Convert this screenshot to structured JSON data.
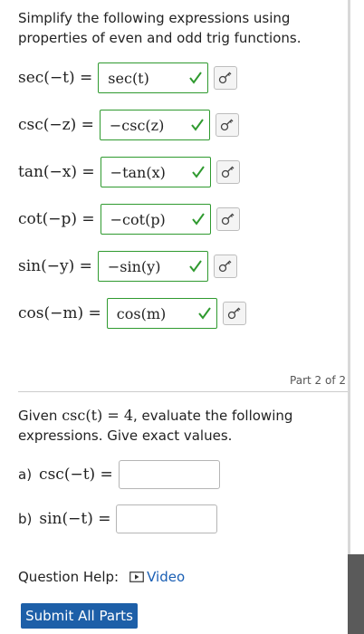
{
  "intro": "Simplify the following expressions using properties of even and odd trig functions.",
  "rows": [
    {
      "lhs": "sec(−t) =",
      "answer": "sec(t)"
    },
    {
      "lhs": "csc(−z) =",
      "answer": "−csc(z)"
    },
    {
      "lhs": "tan(−x) =",
      "answer": "−tan(x)"
    },
    {
      "lhs": "cot(−p) =",
      "answer": "−cot(p)"
    },
    {
      "lhs": "sin(−y) =",
      "answer": "−sin(y)"
    },
    {
      "lhs": "cos(−m) =",
      "answer": "cos(m)"
    }
  ],
  "part_label": "Part 2 of 2",
  "given": {
    "prefix": "Given",
    "math": "csc(t) = 4",
    "suffix": ", evaluate the following expressions. Give exact values."
  },
  "subparts": [
    {
      "label": "a)",
      "eq": "csc(−t) ="
    },
    {
      "label": "b)",
      "eq": "sin(−t) ="
    }
  ],
  "help": {
    "label": "Question Help:",
    "video": "Video"
  },
  "submit_label": "Submit All Parts",
  "colors": {
    "correct": "#2f9a2f",
    "link": "#1a5fb4",
    "submit": "#1d5fa8"
  },
  "icons": {
    "check": "checkmark-icon",
    "key": "key-icon",
    "video": "play-icon"
  }
}
